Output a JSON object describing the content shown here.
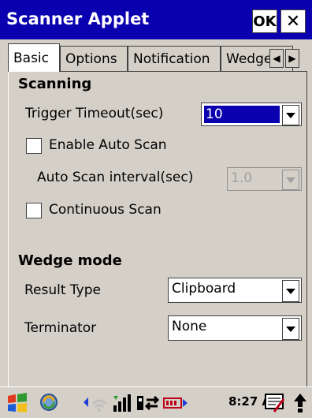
{
  "window": {
    "title": "Scanner Applet",
    "ok_label": "OK",
    "close_label": "✕"
  },
  "tabs": [
    {
      "label": "Basic",
      "active": true
    },
    {
      "label": "Options",
      "active": false
    },
    {
      "label": "Notification",
      "active": false
    },
    {
      "label": "Wedge",
      "active": false
    }
  ],
  "scanning": {
    "group_label": "Scanning",
    "trigger_timeout_label": "Trigger Timeout(sec)",
    "trigger_timeout_value": "10",
    "enable_auto_scan_label": "Enable Auto Scan",
    "enable_auto_scan_checked": false,
    "auto_scan_interval_label": "Auto Scan interval(sec)",
    "auto_scan_interval_value": "1.0",
    "continuous_scan_label": "Continuous Scan",
    "continuous_scan_checked": false
  },
  "wedge": {
    "group_label": "Wedge mode",
    "result_type_label": "Result Type",
    "result_type_value": "Clipboard",
    "terminator_label": "Terminator",
    "terminator_value": "None"
  },
  "taskbar": {
    "clock": "8:27 AM",
    "icons": [
      "start-icon",
      "sync-icon",
      "wifi-icon",
      "signal-icon",
      "connection-icon",
      "battery-icon",
      "input-panel-icon",
      "up-arrow-icon"
    ]
  },
  "colors": {
    "title_bar": "#0b00b0",
    "selection": "#0b00b0",
    "surface": "#d4d0c8"
  }
}
